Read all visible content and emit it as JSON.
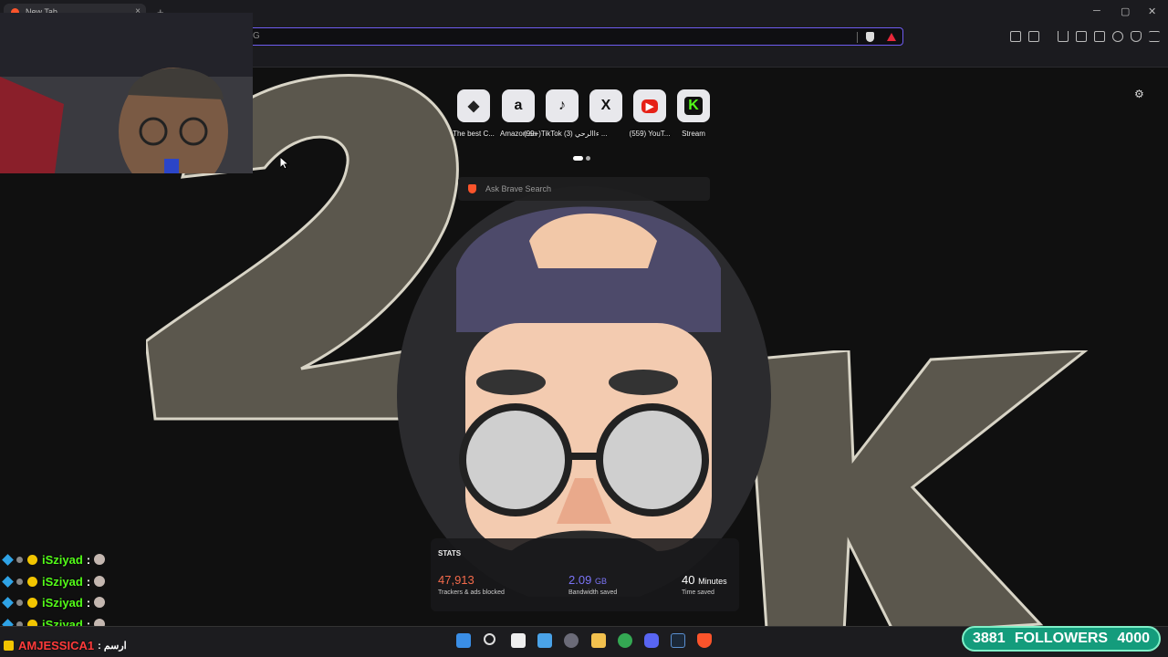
{
  "browser": {
    "tab_title": "New Tab",
    "tab_close": "×",
    "new_tab": "+",
    "window_controls": [
      "─",
      "▢",
      "✕"
    ],
    "url_value": "G"
  },
  "top_sites": [
    {
      "label": "The best C...",
      "icon": "game-controller-icon",
      "glyph": "◆"
    },
    {
      "label": "Amazon.sa",
      "icon": "amazon-icon",
      "glyph": "a"
    },
    {
      "label": "(99+)TikTok (3) ءاالرحي ...",
      "icon": "tiktok-icon",
      "glyph": "♪"
    },
    {
      "label": "X",
      "icon": "x-icon",
      "glyph": "X"
    },
    {
      "label": "(559) YouT...",
      "icon": "youtube-icon",
      "glyph": "▶"
    },
    {
      "label": "Stream",
      "icon": "kick-icon",
      "glyph": "K"
    }
  ],
  "search": {
    "placeholder": "Ask Brave Search"
  },
  "stats": {
    "title": "STATS",
    "trackers": {
      "value": "47,913",
      "caption": "Trackers & ads blocked",
      "color": "#f36a4b"
    },
    "bandwidth": {
      "value": "2.09",
      "unit": "GB",
      "caption": "Bandwidth saved",
      "color": "#7b74f6"
    },
    "time": {
      "value": "40",
      "unit": "Minutes",
      "caption": "Time saved",
      "color": "#ffffff"
    }
  },
  "chat": {
    "messages": [
      {
        "user": "iSziyad",
        "sep": ":"
      },
      {
        "user": "iSziyad",
        "sep": ":"
      },
      {
        "user": "iSziyad",
        "sep": ":"
      },
      {
        "user": "iSziyad",
        "sep": ":"
      }
    ],
    "last": {
      "user": "AMJESSICA1",
      "text": ": ارسم",
      "color": "#ff3b3b"
    }
  },
  "followers": {
    "current": "3881",
    "label": "FOLLOWERS",
    "goal": "4000"
  },
  "taskbar_icons": [
    "windows-start-icon",
    "search-icon",
    "task-view-icon",
    "store-icon",
    "chromium-icon",
    "file-explorer-icon",
    "chrome-icon",
    "discord-icon",
    "steam-icon",
    "brave-icon"
  ]
}
